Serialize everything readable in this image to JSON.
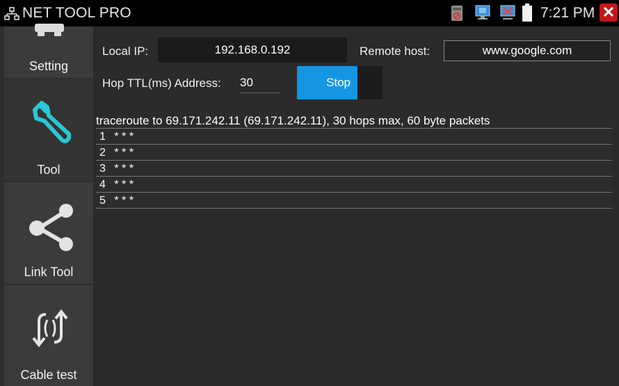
{
  "statusbar": {
    "app_title": "NET TOOL PRO",
    "clock": "7:21 PM",
    "icons": [
      "network-icon",
      "camera-disabled-icon",
      "monitor-icon",
      "wifi-disabled-icon",
      "battery-icon",
      "close-icon"
    ],
    "close_color": "#c01818"
  },
  "sidebar": {
    "items": [
      {
        "label": "Setting",
        "icon": "gear-icon"
      },
      {
        "label": "Tool",
        "icon": "wrench-icon"
      },
      {
        "label": "Link Tool",
        "icon": "share-icon"
      },
      {
        "label": "Cable test",
        "icon": "cable-test-icon"
      }
    ],
    "accent": "#29c7d6"
  },
  "form": {
    "local_ip_label": "Local IP:",
    "local_ip_value": "192.168.0.192",
    "remote_host_label": "Remote host:",
    "remote_host_value": "www.google.com",
    "hop_ttl_label": "Hop TTL(ms) Address:",
    "hop_ttl_value": "30",
    "stop_label": "Stop",
    "stop_color": "#1596e3"
  },
  "traceroute": {
    "header": "traceroute to 69.171.242.11 (69.171.242.11), 30 hops max, 60 byte packets",
    "rows": [
      {
        "num": "1",
        "result": "* * *"
      },
      {
        "num": "2",
        "result": "* * *"
      },
      {
        "num": "3",
        "result": "* * *"
      },
      {
        "num": "4",
        "result": "* * *"
      },
      {
        "num": "5",
        "result": "* * *"
      }
    ]
  }
}
